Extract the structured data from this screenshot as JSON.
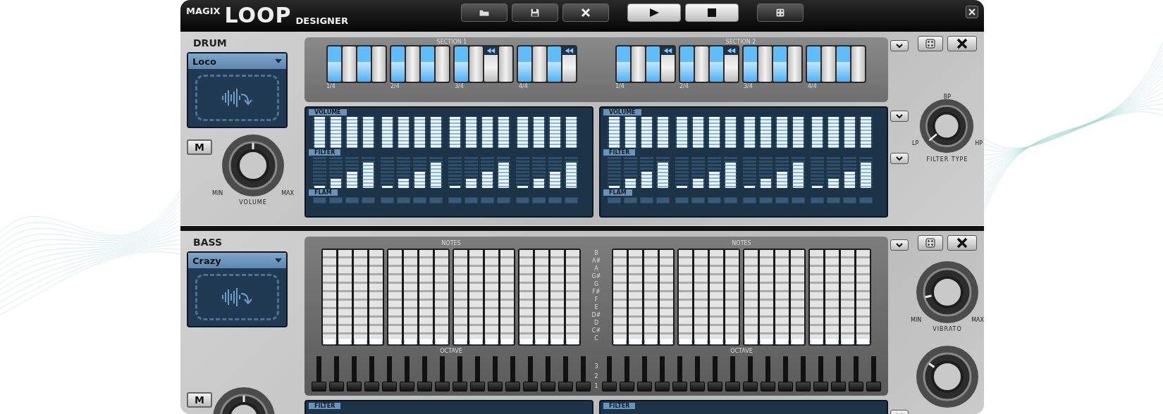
{
  "window": {
    "brand": "MAGIX",
    "logo": "LOOP",
    "product": "DESIGNER"
  },
  "toolbar": [
    {
      "kind": "file"
    },
    {
      "kind": "file"
    },
    {
      "kind": "file"
    },
    {
      "kind": "transport"
    },
    {
      "kind": "transport"
    },
    {
      "kind": "extra"
    }
  ],
  "drum": {
    "title": "DRUM",
    "preset": "Loco",
    "mute": {
      "label": "M",
      "on": false
    },
    "knob": {
      "level": 0.5,
      "min": "MIN",
      "max": "MAX",
      "label": "VOLUME"
    },
    "filter_knob": {
      "level": 0.02,
      "low": "LP",
      "mid": "BP",
      "high": "HP",
      "label": "FILTER TYPE"
    },
    "sections": [
      {
        "title": "SECTION 1",
        "beats": [
          "1/4",
          "2/4",
          "3/4",
          "4/4"
        ],
        "steps": [
          {
            "on": true,
            "roll": false
          },
          {
            "on": false,
            "roll": false
          },
          {
            "on": true,
            "roll": false
          },
          {
            "on": false,
            "roll": false
          },
          {
            "on": true,
            "roll": false
          },
          {
            "on": false,
            "roll": false
          },
          {
            "on": true,
            "roll": false
          },
          {
            "on": false,
            "roll": false
          },
          {
            "on": true,
            "roll": false
          },
          {
            "on": false,
            "roll": false
          },
          {
            "on": false,
            "roll": true
          },
          {
            "on": false,
            "roll": false
          },
          {
            "on": true,
            "roll": false
          },
          {
            "on": false,
            "roll": false
          },
          {
            "on": true,
            "roll": false
          },
          {
            "on": false,
            "roll": true
          }
        ],
        "lanes": [
          {
            "label": "VOLUME",
            "kind": "bars",
            "cells": [
              {
                "level": 1
              },
              {
                "level": 1
              },
              {
                "level": 1
              },
              {
                "level": 1
              },
              {
                "level": 1
              },
              {
                "level": 1
              },
              {
                "level": 1
              },
              {
                "level": 1
              },
              {
                "level": 1
              },
              {
                "level": 1
              },
              {
                "level": 1
              },
              {
                "level": 1
              },
              {
                "level": 1
              },
              {
                "level": 1
              },
              {
                "level": 1
              },
              {
                "level": 1
              }
            ]
          },
          {
            "label": "FILTER",
            "kind": "bars",
            "cells": [
              {
                "level": 0
              },
              {
                "level": 0.25
              },
              {
                "level": 0.5
              },
              {
                "level": 0.8
              },
              {
                "level": 0
              },
              {
                "level": 0.25
              },
              {
                "level": 0.5
              },
              {
                "level": 0.8
              },
              {
                "level": 0
              },
              {
                "level": 0.25
              },
              {
                "level": 0.5
              },
              {
                "level": 0.8
              },
              {
                "level": 0
              },
              {
                "level": 0.25
              },
              {
                "level": 0.5
              },
              {
                "level": 0.8
              }
            ]
          },
          {
            "label": "FLAM",
            "kind": "toggles",
            "cells": [
              {
                "on": false
              },
              {
                "on": false
              },
              {
                "on": false
              },
              {
                "on": false
              },
              {
                "on": false
              },
              {
                "on": false
              },
              {
                "on": false
              },
              {
                "on": false
              },
              {
                "on": false
              },
              {
                "on": false
              },
              {
                "on": false
              },
              {
                "on": false
              },
              {
                "on": false
              },
              {
                "on": false
              },
              {
                "on": false
              },
              {
                "on": false
              }
            ]
          }
        ]
      },
      {
        "title": "SECTION 2",
        "beats": [
          "1/4",
          "2/4",
          "3/4",
          "4/4"
        ],
        "steps": [
          {
            "on": true,
            "roll": false
          },
          {
            "on": false,
            "roll": false
          },
          {
            "on": true,
            "roll": false
          },
          {
            "on": false,
            "roll": true
          },
          {
            "on": true,
            "roll": false
          },
          {
            "on": false,
            "roll": false
          },
          {
            "on": true,
            "roll": false
          },
          {
            "on": false,
            "roll": true
          },
          {
            "on": true,
            "roll": false
          },
          {
            "on": false,
            "roll": false
          },
          {
            "on": true,
            "roll": false
          },
          {
            "on": false,
            "roll": false
          },
          {
            "on": true,
            "roll": false
          },
          {
            "on": false,
            "roll": false
          },
          {
            "on": true,
            "roll": false
          },
          {
            "on": false,
            "roll": false
          }
        ],
        "lanes": [
          {
            "label": "VOLUME",
            "kind": "bars",
            "cells": [
              {
                "level": 1
              },
              {
                "level": 1
              },
              {
                "level": 1
              },
              {
                "level": 1
              },
              {
                "level": 1
              },
              {
                "level": 1
              },
              {
                "level": 1
              },
              {
                "level": 1
              },
              {
                "level": 1
              },
              {
                "level": 1
              },
              {
                "level": 1
              },
              {
                "level": 1
              },
              {
                "level": 1
              },
              {
                "level": 1
              },
              {
                "level": 1
              },
              {
                "level": 1
              }
            ]
          },
          {
            "label": "FILTER",
            "kind": "bars",
            "cells": [
              {
                "level": 0
              },
              {
                "level": 0.25
              },
              {
                "level": 0.5
              },
              {
                "level": 0.8
              },
              {
                "level": 0
              },
              {
                "level": 0.25
              },
              {
                "level": 0.5
              },
              {
                "level": 0.8
              },
              {
                "level": 0
              },
              {
                "level": 0.25
              },
              {
                "level": 0.5
              },
              {
                "level": 0.8
              },
              {
                "level": 0
              },
              {
                "level": 0.25
              },
              {
                "level": 0.5
              },
              {
                "level": 0.8
              }
            ]
          },
          {
            "label": "FLAM",
            "kind": "toggles",
            "cells": [
              {
                "on": false
              },
              {
                "on": false
              },
              {
                "on": false
              },
              {
                "on": false
              },
              {
                "on": false
              },
              {
                "on": false
              },
              {
                "on": false
              },
              {
                "on": false
              },
              {
                "on": false
              },
              {
                "on": false
              },
              {
                "on": false
              },
              {
                "on": false
              },
              {
                "on": false
              },
              {
                "on": false
              },
              {
                "on": false
              },
              {
                "on": false
              }
            ]
          }
        ]
      }
    ]
  },
  "bass": {
    "title": "BASS",
    "preset": "Crazy",
    "mute": {
      "label": "M",
      "on": false
    },
    "knob": {
      "level": 0.5
    },
    "vibrato": {
      "level": 0.12,
      "min": "MIN",
      "max": "MAX",
      "label": "VIBRATO"
    },
    "lower_knob": {
      "level": 0.3
    },
    "note_labels": [
      "B",
      "A#",
      "A",
      "G#",
      "G",
      "F#",
      "F",
      "E",
      "D#",
      "D",
      "C#",
      "C"
    ],
    "octave_labels": [
      "3",
      "2",
      "1"
    ],
    "sections": [
      {
        "notes_title": "NOTES",
        "octave_title": "OCTAVE",
        "notes": [
          {
            "level": 0
          },
          {
            "level": 0
          },
          {
            "level": 0
          },
          {
            "level": 0
          },
          {
            "level": 0
          },
          {
            "level": 0
          },
          {
            "level": 0
          },
          {
            "level": 0
          },
          {
            "level": 0
          },
          {
            "level": 0
          },
          {
            "level": 0
          },
          {
            "level": 0
          },
          {
            "level": 0
          },
          {
            "level": 0
          },
          {
            "level": 0
          },
          {
            "level": 0
          }
        ],
        "octaves": [
          {
            "level": 0
          },
          {
            "level": 0
          },
          {
            "level": 0
          },
          {
            "level": 0
          },
          {
            "level": 0
          },
          {
            "level": 0
          },
          {
            "level": 0
          },
          {
            "level": 0
          },
          {
            "level": 0
          },
          {
            "level": 0
          },
          {
            "level": 0
          },
          {
            "level": 0
          },
          {
            "level": 0
          },
          {
            "level": 0
          },
          {
            "level": 0
          },
          {
            "level": 0
          }
        ]
      },
      {
        "notes_title": "NOTES",
        "octave_title": "OCTAVE",
        "notes": [
          {
            "level": 0
          },
          {
            "level": 0
          },
          {
            "level": 0
          },
          {
            "level": 0
          },
          {
            "level": 0
          },
          {
            "level": 0
          },
          {
            "level": 0
          },
          {
            "level": 0
          },
          {
            "level": 0
          },
          {
            "level": 0
          },
          {
            "level": 0
          },
          {
            "level": 0
          },
          {
            "level": 0
          },
          {
            "level": 0
          },
          {
            "level": 0
          },
          {
            "level": 0
          }
        ],
        "octaves": [
          {
            "level": 0
          },
          {
            "level": 0
          },
          {
            "level": 0
          },
          {
            "level": 0
          },
          {
            "level": 0
          },
          {
            "level": 0
          },
          {
            "level": 0
          },
          {
            "level": 0
          },
          {
            "level": 0
          },
          {
            "level": 0
          },
          {
            "level": 0
          },
          {
            "level": 0
          },
          {
            "level": 0
          },
          {
            "level": 0
          },
          {
            "level": 0
          },
          {
            "level": 0
          }
        ]
      }
    ],
    "lanes": [
      {
        "label": "FILTER"
      },
      {
        "label": "FILTER"
      }
    ]
  }
}
